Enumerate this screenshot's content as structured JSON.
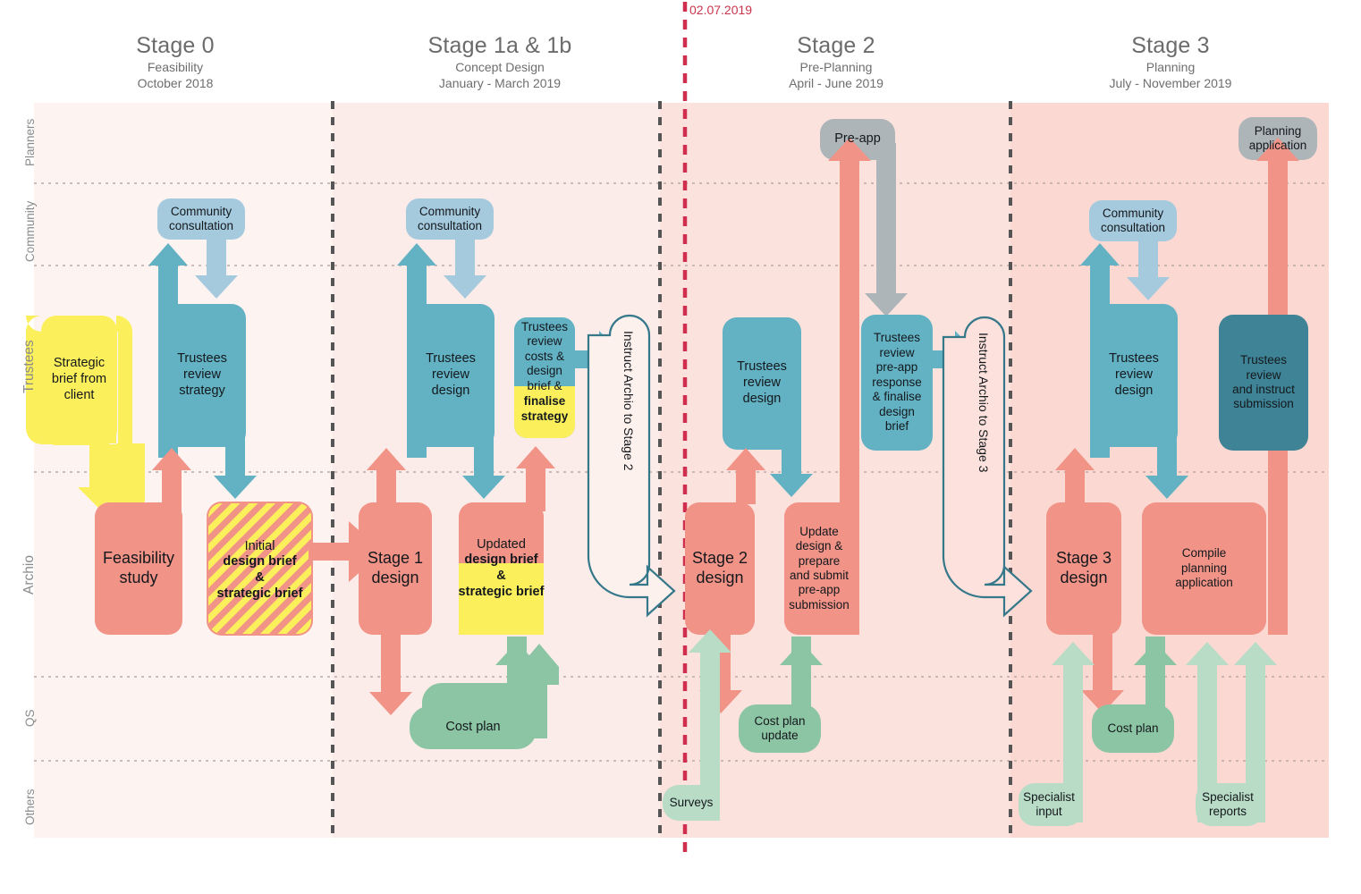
{
  "title": "Project programme timeline diagram",
  "milestone": {
    "date": "02.07.2019",
    "color": "#cf2e4e"
  },
  "stages": [
    {
      "name": "Stage 0",
      "phase": "Feasibility",
      "dates": "October 2018"
    },
    {
      "name": "Stage 1a & 1b",
      "phase": "Concept Design",
      "dates": "January - March 2019"
    },
    {
      "name": "Stage 2",
      "phase": "Pre-Planning",
      "dates": "April - June 2019"
    },
    {
      "name": "Stage 3",
      "phase": "Planning",
      "dates": "July - November 2019"
    }
  ],
  "swimlanes": [
    {
      "label": "Planners"
    },
    {
      "label": "Community"
    },
    {
      "label": "Trustees"
    },
    {
      "label": "Archio"
    },
    {
      "label": "QS"
    },
    {
      "label": "Others"
    }
  ],
  "palette": {
    "red": "#f19387",
    "red_dark": "#ee8e82",
    "blue": "#62b2c4",
    "blue_light": "#a5cade",
    "blue_dark": "#3e8496",
    "teal_outline": "#35788a",
    "yellow": "#fbf05b",
    "green": "#8cc5a4",
    "green_light": "#b8dcc6",
    "grey": "#adb5b9",
    "band_s0": "#fdf3f1",
    "band_s1": "#fcece9",
    "band_s2": "#fce2dd",
    "band_s3": "#fbd9d2"
  },
  "nodes": {
    "s0_strategic_brief": "Strategic\nbrief from\nclient",
    "s0_community": "Community\nconsultation",
    "s0_trustees": "Trustees\nreview\nstrategy",
    "s0_feasibility": "Feasibility\nstudy",
    "s0_initial_brief_line1": "Initial",
    "s0_initial_brief_line2": "design brief",
    "s0_initial_brief_line3": "&",
    "s0_initial_brief_line4": "strategic brief",
    "s1_community": "Community\nconsultation",
    "s1_trustees_design": "Trustees\nreview\ndesign",
    "s1_trustees_costs_top": "Trustees\nreview\ncosts &\ndesign\nbrief &",
    "s1_trustees_costs_bottom": "finalise\nstrategy",
    "s1_instruct": "Instruct Archio to Stage 2",
    "s1_stage1_design": "Stage 1\ndesign",
    "s1_updated_top": "Updated",
    "s1_updated_mid": "design brief",
    "s1_updated_amp": "&",
    "s1_updated_bottom": "strategic brief",
    "s1_cost_plan": "Cost plan",
    "s2_preapp": "Pre-app",
    "s2_trustees_design": "Trustees\nreview\ndesign",
    "s2_trustees_preapp": "Trustees\nreview\npre-app\nresponse\n& finalise\ndesign\nbrief",
    "s2_instruct": "Instruct Archio to Stage 3",
    "s2_stage2_design": "Stage 2\ndesign",
    "s2_update_design": "Update\ndesign &\nprepare\nand submit\npre-app\nsubmission",
    "s2_cost_plan_update": "Cost plan\nupdate",
    "s2_surveys": "Surveys",
    "s3_planning_application": "Planning\napplication",
    "s3_community": "Community\nconsultation",
    "s3_trustees_design": "Trustees\nreview\ndesign",
    "s3_trustees_instruct": "Trustees\nreview\nand instruct\nsubmission",
    "s3_stage3_design": "Stage 3\ndesign",
    "s3_compile": "Compile\nplanning\napplication",
    "s3_cost_plan": "Cost plan",
    "s3_specialist_input": "Specialist\ninput",
    "s3_specialist_reports": "Specialist\nreports"
  },
  "chart_data": {
    "type": "table",
    "title": "RIBA Stage programme swimlane diagram",
    "columns": [
      "Stage 0 / Feasibility / October 2018",
      "Stage 1a & 1b / Concept Design / January - March 2019",
      "Stage 2 / Pre-Planning / April - June 2019",
      "Stage 3 / Planning / July - November 2019"
    ],
    "rows": [
      "Planners",
      "Community",
      "Trustees",
      "Archio",
      "QS",
      "Others"
    ],
    "milestone_marker": "02.07.2019",
    "cells": [
      {
        "lane": "Planners",
        "stage": "Stage 2",
        "items": [
          "Pre-app"
        ]
      },
      {
        "lane": "Planners",
        "stage": "Stage 3",
        "items": [
          "Planning application"
        ]
      },
      {
        "lane": "Community",
        "stage": "Stage 0",
        "items": [
          "Community consultation"
        ]
      },
      {
        "lane": "Community",
        "stage": "Stage 1a & 1b",
        "items": [
          "Community consultation"
        ]
      },
      {
        "lane": "Community",
        "stage": "Stage 3",
        "items": [
          "Community consultation"
        ]
      },
      {
        "lane": "Trustees",
        "stage": "Stage 0",
        "items": [
          "Strategic brief from client",
          "Trustees review strategy"
        ]
      },
      {
        "lane": "Trustees",
        "stage": "Stage 1a & 1b",
        "items": [
          "Trustees review design",
          "Trustees review costs & design brief & finalise strategy",
          "Instruct Archio to Stage 2"
        ]
      },
      {
        "lane": "Trustees",
        "stage": "Stage 2",
        "items": [
          "Trustees review design",
          "Trustees review pre-app response & finalise design brief",
          "Instruct Archio to Stage 3"
        ]
      },
      {
        "lane": "Trustees",
        "stage": "Stage 3",
        "items": [
          "Trustees review design",
          "Trustees review and instruct submission"
        ]
      },
      {
        "lane": "Archio",
        "stage": "Stage 0",
        "items": [
          "Feasibility study",
          "Initial design brief & strategic brief"
        ]
      },
      {
        "lane": "Archio",
        "stage": "Stage 1a & 1b",
        "items": [
          "Stage 1 design",
          "Updated design brief & strategic brief"
        ]
      },
      {
        "lane": "Archio",
        "stage": "Stage 2",
        "items": [
          "Stage 2 design",
          "Update design & prepare and submit pre-app submission"
        ]
      },
      {
        "lane": "Archio",
        "stage": "Stage 3",
        "items": [
          "Stage 3 design",
          "Compile planning application"
        ]
      },
      {
        "lane": "QS",
        "stage": "Stage 1a & 1b",
        "items": [
          "Cost plan"
        ]
      },
      {
        "lane": "QS",
        "stage": "Stage 2",
        "items": [
          "Cost plan update"
        ]
      },
      {
        "lane": "QS",
        "stage": "Stage 3",
        "items": [
          "Cost plan"
        ]
      },
      {
        "lane": "Others",
        "stage": "Stage 2",
        "items": [
          "Surveys"
        ]
      },
      {
        "lane": "Others",
        "stage": "Stage 3",
        "items": [
          "Specialist input",
          "Specialist reports"
        ]
      }
    ]
  }
}
